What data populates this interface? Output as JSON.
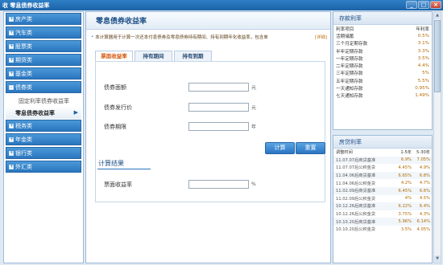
{
  "window": {
    "title": "收 零息债券收益率",
    "buttons": [
      "_",
      "□",
      "×"
    ]
  },
  "sidebar": {
    "items": [
      {
        "label": "房产类",
        "type": "cat",
        "sign": "+"
      },
      {
        "label": "汽车类",
        "type": "cat",
        "sign": "+"
      },
      {
        "label": "股票类",
        "type": "cat",
        "sign": "+"
      },
      {
        "label": "期货类",
        "type": "cat",
        "sign": "+"
      },
      {
        "label": "基金类",
        "type": "cat",
        "sign": "+"
      },
      {
        "label": "债券类",
        "type": "cat",
        "sign": "-"
      },
      {
        "label": "固定利率债券收益率",
        "type": "sub"
      },
      {
        "label": "零息债券收益率",
        "type": "sub-active",
        "arrow": "▶"
      },
      {
        "label": "税务类",
        "type": "cat",
        "sign": "+"
      },
      {
        "label": "年金类",
        "type": "cat",
        "sign": "+"
      },
      {
        "label": "银行类",
        "type": "cat",
        "sign": "+"
      },
      {
        "label": "外汇类",
        "type": "cat",
        "sign": "+"
      }
    ]
  },
  "main": {
    "title": "零息债券收益率",
    "description": "本计算器用于计算一次还本付息债券及零息债券持有期间、持有到期年化收益率，包含单",
    "detail_link": "[详细]",
    "tabs": [
      "票面收益率",
      "持有期间",
      "持有到期"
    ],
    "fields": [
      {
        "label": "债券面额",
        "unit": "元"
      },
      {
        "label": "债券发行价",
        "unit": "元"
      },
      {
        "label": "债券期限",
        "unit": "年"
      }
    ],
    "calc_button": "计算",
    "reset_button": "重置",
    "result_title": "计算结果",
    "result_field": {
      "label": "票面收益率",
      "unit": "%"
    }
  },
  "deposit": {
    "title": "存款利率",
    "header": [
      "利率项目",
      "年利率"
    ],
    "rows": [
      [
        "活期储蓄",
        "0.5%"
      ],
      [
        "三个月定期存款",
        "3.1%"
      ],
      [
        "半年定期存款",
        "3.3%"
      ],
      [
        "一年定期存款",
        "3.5%"
      ],
      [
        "二年定期存款",
        "4.4%"
      ],
      [
        "三年定期存款",
        "5%"
      ],
      [
        "五年定期存款",
        "5.5%"
      ],
      [
        "一天通知存款",
        "0.95%"
      ],
      [
        "七天通知存款",
        "1.49%"
      ]
    ]
  },
  "loan": {
    "title": "房贷利率",
    "header": [
      "调整时间",
      "1-5年",
      "5-30年"
    ],
    "rows": [
      [
        "11.07.07后商贷基准",
        "6.9%",
        "7.05%"
      ],
      [
        "11.07.07后公积金贷",
        "4.45%",
        "4.9%"
      ],
      [
        "11.04.06后商贷基准",
        "6.65%",
        "6.8%"
      ],
      [
        "11.04.06后公积金贷",
        "4.2%",
        "4.7%"
      ],
      [
        "11.02.09后商贷基准",
        "6.45%",
        "6.6%"
      ],
      [
        "11.02.09后公积金贷",
        "4%",
        "4.5%"
      ],
      [
        "10.12.26后商贷基准",
        "6.22%",
        "6.4%"
      ],
      [
        "10.12.26后公积金贷",
        "3.75%",
        "4.3%"
      ],
      [
        "10.10.20后商贷基准",
        "5.96%",
        "6.14%"
      ],
      [
        "10.10.20后公积金贷",
        "3.5%",
        "4.05%"
      ]
    ]
  },
  "colors": {
    "accent": "#2a76bf",
    "value": "#b36b00",
    "tab_active": "#d4580e"
  }
}
